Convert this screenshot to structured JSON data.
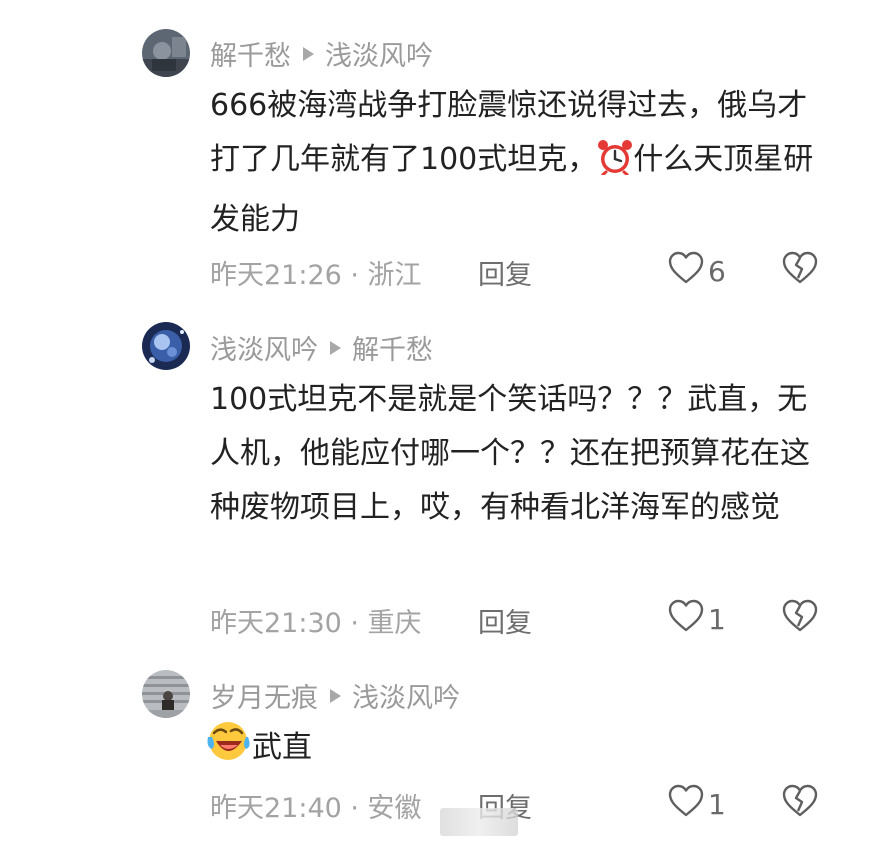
{
  "comments": [
    {
      "user": "解千愁",
      "reply_to": "浅淡风吟",
      "text_parts": [
        "666被海湾战争打脸震惊还说得过去，俄乌才打了几年就有了100式坦克，",
        "什么天顶星研发能力"
      ],
      "emoji": "alarm-clock",
      "time": "昨天21:26 · 浙江",
      "reply_label": "回复",
      "likes": "6"
    },
    {
      "user": "浅淡风吟",
      "reply_to": "解千愁",
      "text": "100式坦克不是就是个笑话吗？？？武直，无人机，他能应付哪一个？？还在把预算花在这种废物项目上，哎，有种看北洋海军的感觉",
      "time": "昨天21:30 · 重庆",
      "reply_label": "回复",
      "likes": "1"
    },
    {
      "user": "岁月无痕",
      "reply_to": "浅淡风吟",
      "emoji": "laughing-emoji",
      "text": "武直",
      "time": "昨天21:40 · 安徽",
      "reply_label": "回复",
      "likes": "1"
    }
  ],
  "icons": {
    "reply_arrow": "play-triangle-icon",
    "like": "heart-icon",
    "dislike": "broken-heart-icon"
  },
  "colors": {
    "meta_text": "#a3a3a3",
    "body_text": "#222222",
    "alarm_red": "#e53935"
  }
}
